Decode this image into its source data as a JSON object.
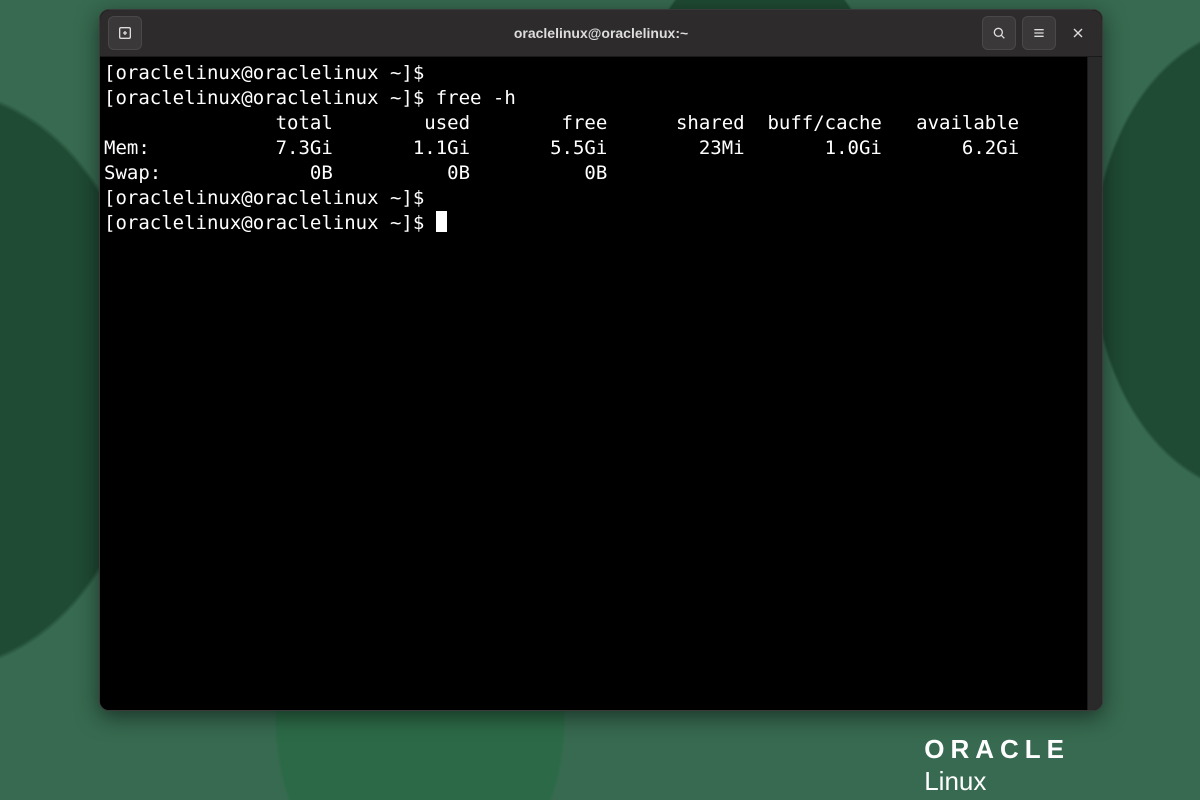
{
  "window": {
    "title": "oraclelinux@oraclelinux:~"
  },
  "terminal": {
    "prompt": "[oraclelinux@oraclelinux ~]$ ",
    "lines": [
      "[oraclelinux@oraclelinux ~]$ ",
      "[oraclelinux@oraclelinux ~]$ free -h",
      "               total        used        free      shared  buff/cache   available",
      "Mem:           7.3Gi       1.1Gi       5.5Gi        23Mi       1.0Gi       6.2Gi",
      "Swap:             0B          0B          0B",
      "[oraclelinux@oraclelinux ~]$ ",
      "[oraclelinux@oraclelinux ~]$ "
    ],
    "command": "free -h",
    "table": {
      "headers": [
        "total",
        "used",
        "free",
        "shared",
        "buff/cache",
        "available"
      ],
      "rows": [
        {
          "label": "Mem:",
          "total": "7.3Gi",
          "used": "1.1Gi",
          "free": "5.5Gi",
          "shared": "23Mi",
          "buff_cache": "1.0Gi",
          "available": "6.2Gi"
        },
        {
          "label": "Swap:",
          "total": "0B",
          "used": "0B",
          "free": "0B",
          "shared": "",
          "buff_cache": "",
          "available": ""
        }
      ]
    }
  },
  "brand": {
    "line1": "ORACLE",
    "line2": "Linux"
  },
  "icons": {
    "new_tab": "new-tab-icon",
    "search": "search-icon",
    "menu": "hamburger-icon",
    "close": "close-icon"
  }
}
